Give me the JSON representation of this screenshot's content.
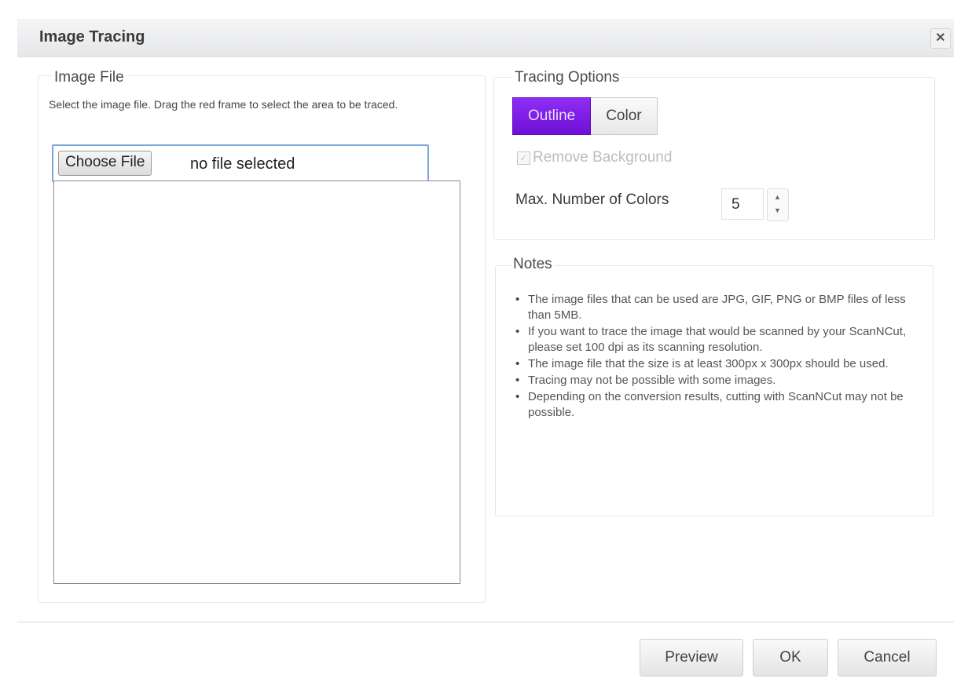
{
  "dialog": {
    "title": "Image Tracing",
    "close_icon": "close-icon"
  },
  "image_file": {
    "legend": "Image File",
    "hint": "Select the image file. Drag the red frame to select the area to be traced.",
    "choose_button": "Choose File",
    "file_status": "no file selected"
  },
  "tracing_options": {
    "legend": "Tracing Options",
    "modes": [
      "Outline",
      "Color"
    ],
    "selected_mode": "Outline",
    "remove_background_label": "Remove Background",
    "remove_background_checked": true,
    "remove_background_enabled": false,
    "max_colors_label": "Max. Number of Colors",
    "max_colors_value": "5"
  },
  "notes": {
    "legend": "Notes",
    "items": [
      "The image files that can be used are JPG, GIF, PNG or BMP files of less than 5MB.",
      "If you want to trace the image that would be scanned by your ScanNCut, please set 100 dpi as its scanning resolution.",
      "The image file that the size is at least 300px x 300px should be used.",
      "Tracing may not be possible with some images.",
      "Depending on the conversion results, cutting with ScanNCut may not be possible."
    ]
  },
  "footer": {
    "preview": "Preview",
    "ok": "OK",
    "cancel": "Cancel"
  },
  "colors": {
    "accent": "#7a1ee6",
    "title_bar": "#eceeef"
  }
}
